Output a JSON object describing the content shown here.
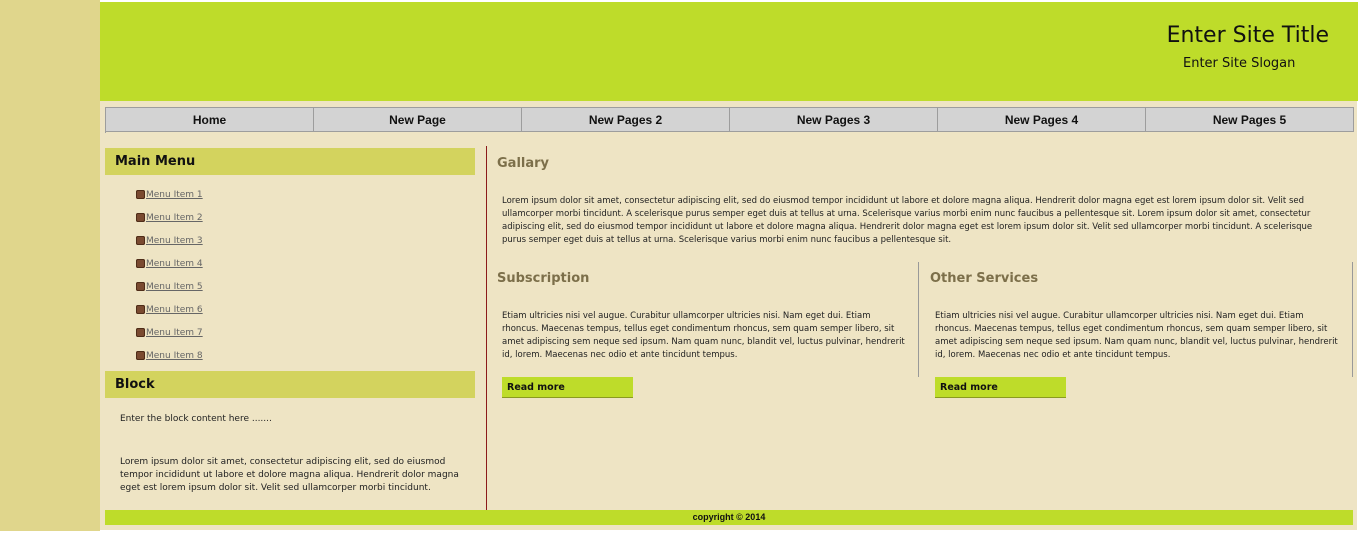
{
  "header": {
    "site_title": "Enter Site Title",
    "site_slogan": "Enter Site Slogan"
  },
  "nav": {
    "items": [
      "Home",
      "New Page",
      "New Pages 2",
      "New Pages 3",
      "New Pages 4",
      "New Pages 5"
    ]
  },
  "sidebar": {
    "main_menu_title": "Main Menu",
    "menu_items": [
      "Menu Item 1",
      "Menu Item 2",
      "Menu Item 3",
      "Menu Item 4",
      "Menu Item 5",
      "Menu Item 6",
      "Menu Item 7",
      "Menu Item 8"
    ],
    "block_title": "Block",
    "block_intro": "Enter the block content here .......",
    "block_body": "Lorem ipsum dolor sit amet, consectetur adipiscing elit, sed do eiusmod tempor incididunt ut labore et dolore magna aliqua. Hendrerit dolor magna eget est lorem ipsum dolor sit. Velit sed ullamcorper morbi tincidunt."
  },
  "main": {
    "gallery_title": "Gallary",
    "gallery_text": "Lorem ipsum dolor sit amet, consectetur adipiscing elit, sed do eiusmod tempor incididunt ut labore et dolore magna aliqua. Hendrerit dolor magna eget est lorem ipsum dolor sit. Velit sed ullamcorper morbi tincidunt. A scelerisque purus semper eget duis at tellus at urna. Scelerisque varius morbi enim nunc faucibus a pellentesque sit. Lorem ipsum dolor sit amet, consectetur adipiscing elit, sed do eiusmod tempor incididunt ut labore et dolore magna aliqua. Hendrerit dolor magna eget est lorem ipsum dolor sit. Velit sed ullamcorper morbi tincidunt. A scelerisque purus semper eget duis at tellus at urna. Scelerisque varius morbi enim nunc faucibus a pellentesque sit.",
    "subscription_title": "Subscription",
    "subscription_text": "Etiam ultricies nisi vel augue. Curabitur ullamcorper ultricies nisi. Nam eget dui. Etiam rhoncus. Maecenas tempus, tellus eget condimentum rhoncus, sem quam semper libero, sit amet adipiscing sem neque sed ipsum. Nam quam nunc, blandit vel, luctus pulvinar, hendrerit id, lorem. Maecenas nec odio et ante tincidunt tempus.",
    "subscription_button": "Read more",
    "services_title": "Other Services",
    "services_text": "Etiam ultricies nisi vel augue. Curabitur ullamcorper ultricies nisi. Nam eget dui. Etiam rhoncus. Maecenas tempus, tellus eget condimentum rhoncus, sem quam semper libero, sit amet adipiscing sem neque sed ipsum. Nam quam nunc, blandit vel, luctus pulvinar, hendrerit id, lorem. Maecenas nec odio et ante tincidunt tempus.",
    "services_button": "Read more"
  },
  "footer": {
    "copyright": "copyright © 2014"
  },
  "colors": {
    "header_green": "#bedc2a",
    "content_bg": "#eee4c4",
    "side_strip": "#e0d68c",
    "block_header": "#d3d35e",
    "nav_gray": "#d3d3d3",
    "divider_red": "#8b1a1a"
  },
  "icons": {
    "menu_bullet": "bullet-icon"
  }
}
